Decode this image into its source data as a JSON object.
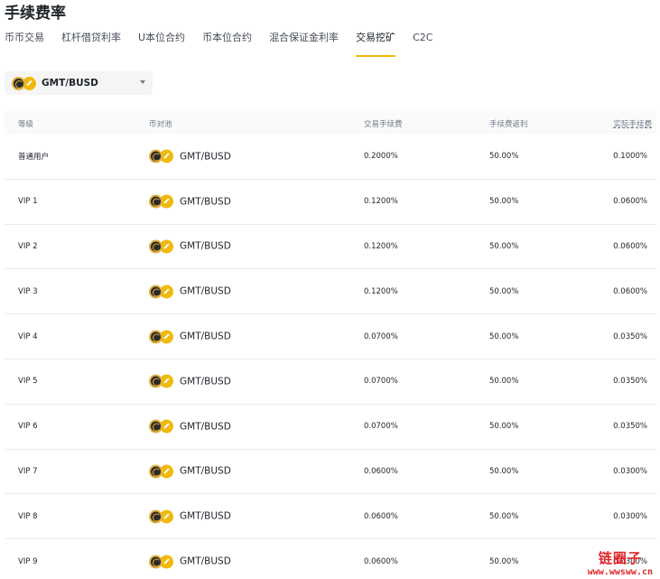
{
  "page": {
    "title": "手续费率"
  },
  "tabs": [
    {
      "label": "币币交易"
    },
    {
      "label": "杠杆借贷利率"
    },
    {
      "label": "U本位合约"
    },
    {
      "label": "币本位合约"
    },
    {
      "label": "混合保证金利率"
    },
    {
      "label": "交易挖矿",
      "active": true
    },
    {
      "label": "C2C"
    }
  ],
  "selector": {
    "value": "GMT/BUSD"
  },
  "table": {
    "headers": {
      "level": "等级",
      "pair": "币对池",
      "fee": "交易手续费",
      "rebate": "手续费返利",
      "actual": "实际手续费"
    },
    "rows": [
      {
        "level": "普通用户",
        "pair": "GMT/BUSD",
        "fee": "0.2000%",
        "rebate": "50.00%",
        "actual": "0.1000%"
      },
      {
        "level": "VIP 1",
        "pair": "GMT/BUSD",
        "fee": "0.1200%",
        "rebate": "50.00%",
        "actual": "0.0600%"
      },
      {
        "level": "VIP 2",
        "pair": "GMT/BUSD",
        "fee": "0.1200%",
        "rebate": "50.00%",
        "actual": "0.0600%"
      },
      {
        "level": "VIP 3",
        "pair": "GMT/BUSD",
        "fee": "0.1200%",
        "rebate": "50.00%",
        "actual": "0.0600%"
      },
      {
        "level": "VIP 4",
        "pair": "GMT/BUSD",
        "fee": "0.0700%",
        "rebate": "50.00%",
        "actual": "0.0350%"
      },
      {
        "level": "VIP 5",
        "pair": "GMT/BUSD",
        "fee": "0.0700%",
        "rebate": "50.00%",
        "actual": "0.0350%"
      },
      {
        "level": "VIP 6",
        "pair": "GMT/BUSD",
        "fee": "0.0700%",
        "rebate": "50.00%",
        "actual": "0.0350%"
      },
      {
        "level": "VIP 7",
        "pair": "GMT/BUSD",
        "fee": "0.0600%",
        "rebate": "50.00%",
        "actual": "0.0300%"
      },
      {
        "level": "VIP 8",
        "pair": "GMT/BUSD",
        "fee": "0.0600%",
        "rebate": "50.00%",
        "actual": "0.0300%"
      },
      {
        "level": "VIP 9",
        "pair": "GMT/BUSD",
        "fee": "0.0600%",
        "rebate": "50.00%",
        "actual": "0.0300%"
      }
    ]
  },
  "watermark": {
    "top": "链圈子",
    "bottom": "www.wwsww.cn"
  },
  "colors": {
    "accent": "#f0b90b",
    "busd": "#f0b90b",
    "gmt_ring": "#e2b13c",
    "watermark": "#e0282b"
  },
  "icons": {
    "pair_icon": [
      "gmt-coin-icon",
      "busd-coin-icon"
    ],
    "dropdown": "chevron-down-icon"
  }
}
